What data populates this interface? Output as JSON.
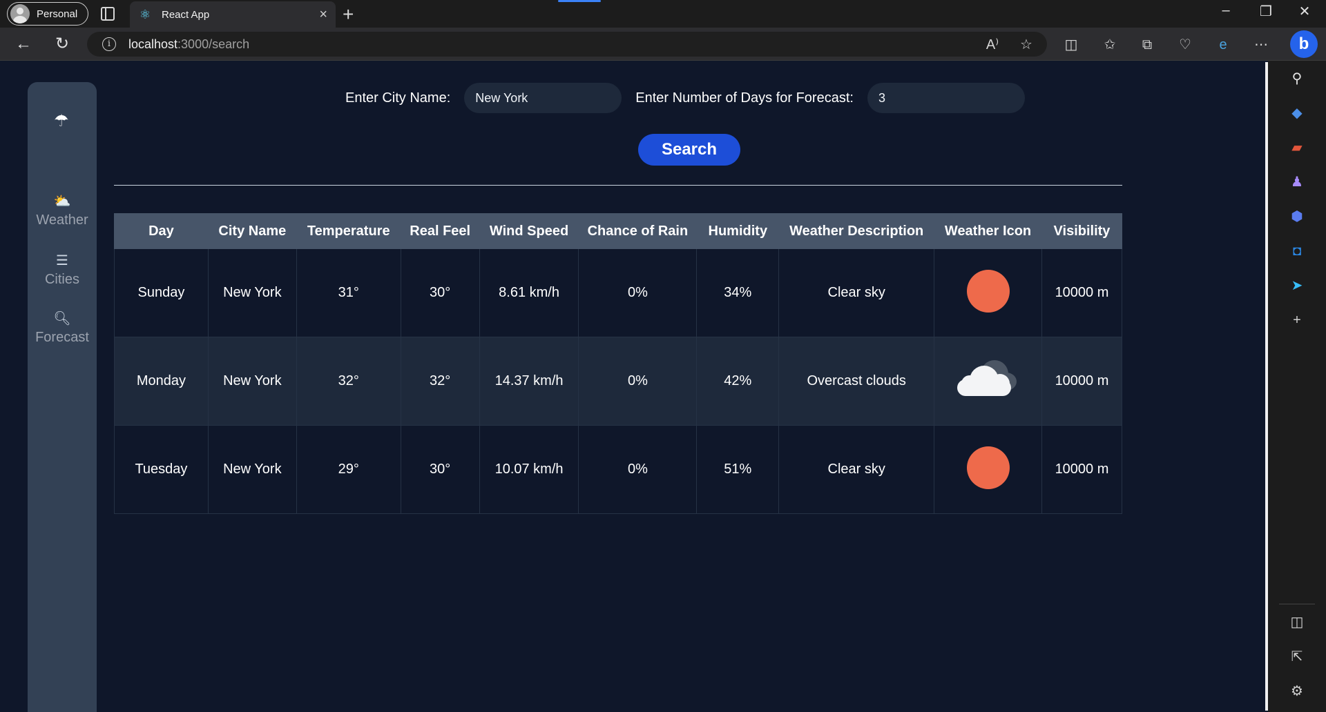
{
  "browser": {
    "profile_label": "Personal",
    "tab_title": "React App",
    "url_host": "localhost",
    "url_path": ":3000/search"
  },
  "sidebar": {
    "items": [
      {
        "label": "Weather",
        "icon": "cloud-sun-icon"
      },
      {
        "label": "Cities",
        "icon": "list-icon"
      },
      {
        "label": "Forecast",
        "icon": "magnifier-icon"
      }
    ]
  },
  "form": {
    "city_label": "Enter City Name:",
    "city_value": "New York",
    "days_label": "Enter Number of Days for Forecast:",
    "days_value": "3",
    "search_label": "Search"
  },
  "table": {
    "headers": [
      "Day",
      "City Name",
      "Temperature",
      "Real Feel",
      "Wind Speed",
      "Chance of Rain",
      "Humidity",
      "Weather Description",
      "Weather Icon",
      "Visibility"
    ],
    "rows": [
      {
        "day": "Sunday",
        "city": "New York",
        "temp": "31°",
        "feel": "30°",
        "wind": "8.61 km/h",
        "rain": "0%",
        "humidity": "34%",
        "desc": "Clear sky",
        "icon": "sun-icon",
        "visibility": "10000 m"
      },
      {
        "day": "Monday",
        "city": "New York",
        "temp": "32°",
        "feel": "32°",
        "wind": "14.37 km/h",
        "rain": "0%",
        "humidity": "42%",
        "desc": "Overcast clouds",
        "icon": "cloud-icon",
        "visibility": "10000 m"
      },
      {
        "day": "Tuesday",
        "city": "New York",
        "temp": "29°",
        "feel": "30°",
        "wind": "10.07 km/h",
        "rain": "0%",
        "humidity": "51%",
        "desc": "Clear sky",
        "icon": "sun-icon",
        "visibility": "10000 m"
      }
    ]
  },
  "colors": {
    "page_bg": "#0f172a",
    "sidebar_bg": "#334155",
    "header_bg": "#475569",
    "button_bg": "#1d4ed8",
    "sun": "#ee6a4b"
  }
}
